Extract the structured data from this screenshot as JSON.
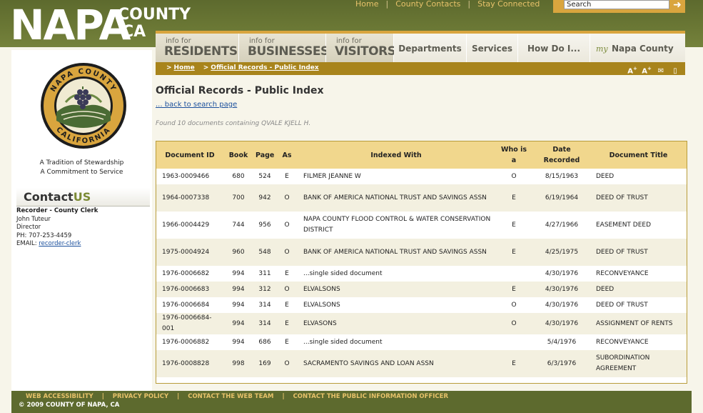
{
  "logo": {
    "napa": "NAPA",
    "county": "COUNTY",
    "ca": "CA"
  },
  "utility_links": [
    "Home",
    "County Contacts",
    "Stay Connected"
  ],
  "search": {
    "value": "Search"
  },
  "nav": {
    "residents": {
      "small": "info for",
      "big": "RESIDENTS"
    },
    "businesses": {
      "small": "info for",
      "big": "BUSINESSES"
    },
    "visitors": {
      "small": "info for",
      "big": "VISITORS"
    },
    "departments": "Departments",
    "services": "Services",
    "how_do_i": "How Do I...",
    "my": "my",
    "my_rest": "Napa County"
  },
  "breadcrumb": {
    "home": "Home",
    "current": "Official Records - Public Index"
  },
  "sidebar": {
    "seal_text_top": "NAPA COUNTY",
    "seal_text_bottom": "CALIFORNIA",
    "tagline_1": "A Tradition of Stewardship",
    "tagline_2": "A Commitment to Service",
    "contact_title_a": "Contact",
    "contact_title_b": "US",
    "dept": "Recorder - County Clerk",
    "name": "John Tuteur",
    "role": "Director",
    "phone": "PH: 707-253-4459",
    "email_label": "EMAIL: ",
    "email_link": "recorder-clerk"
  },
  "main": {
    "title": "Official Records - Public Index",
    "back_link": "... back to search page",
    "found": "Found 10 documents containing QVALE KJELL H."
  },
  "table": {
    "headers": {
      "doc_id": "Document ID",
      "book": "Book",
      "page": "Page",
      "as": "As",
      "indexed_with": "Indexed With",
      "who_is_1": "Who is",
      "who_is_2": "a",
      "date_1": "Date",
      "date_2": "Recorded",
      "title": "Document Title"
    },
    "rows": [
      {
        "id": "1963-0009466",
        "book": "680",
        "page": "524",
        "as": "E",
        "with": "FILMER JEANNE W",
        "who": "O",
        "date": "8/15/1963",
        "title": "DEED"
      },
      {
        "id": "1964-0007338",
        "book": "700",
        "page": "942",
        "as": "O",
        "with": "BANK OF AMERICA NATIONAL TRUST AND SAVINGS ASSN",
        "who": "E",
        "date": "6/19/1964",
        "title": "DEED OF TRUST"
      },
      {
        "id": "1966-0004429",
        "book": "744",
        "page": "956",
        "as": "O",
        "with": "NAPA COUNTY FLOOD CONTROL & WATER CONSERVATION DISTRICT",
        "who": "E",
        "date": "4/27/1966",
        "title": "EASEMENT DEED"
      },
      {
        "id": "1975-0004924",
        "book": "960",
        "page": "548",
        "as": "O",
        "with": "BANK OF AMERICA NATIONAL TRUST AND SAVINGS ASSN",
        "who": "E",
        "date": "4/25/1975",
        "title": "DEED OF TRUST"
      },
      {
        "id": "1976-0006682",
        "book": "994",
        "page": "311",
        "as": "E",
        "with": "...single sided document",
        "who": "",
        "date": "4/30/1976",
        "title": "RECONVEYANCE"
      },
      {
        "id": "1976-0006683",
        "book": "994",
        "page": "312",
        "as": "O",
        "with": "ELVALSONS",
        "who": "E",
        "date": "4/30/1976",
        "title": "DEED"
      },
      {
        "id": "1976-0006684",
        "book": "994",
        "page": "314",
        "as": "E",
        "with": "ELVALSONS",
        "who": "O",
        "date": "4/30/1976",
        "title": "DEED OF TRUST"
      },
      {
        "id": "1976-0006684-001",
        "book": "994",
        "page": "314",
        "as": "E",
        "with": "ELVASONS",
        "who": "O",
        "date": "4/30/1976",
        "title": "ASSIGNMENT OF RENTS"
      },
      {
        "id": "1976-0006882",
        "book": "994",
        "page": "686",
        "as": "E",
        "with": "...single sided document",
        "who": "",
        "date": "5/4/1976",
        "title": "RECONVEYANCE"
      },
      {
        "id": "1976-0008828",
        "book": "998",
        "page": "169",
        "as": "O",
        "with": "SACRAMENTO SAVINGS AND LOAN ASSN",
        "who": "E",
        "date": "6/3/1976",
        "title": "SUBORDINATION AGREEMENT"
      }
    ]
  },
  "footer": {
    "links": [
      "WEB ACCESSIBILITY",
      "PRIVACY POLICY",
      "CONTACT THE WEB TEAM",
      "CONTACT THE PUBLIC INFORMATION OFFICER"
    ],
    "copyright": "© 2009 COUNTY OF NAPA, CA"
  },
  "colors": {
    "header_green": "#5d6a2e",
    "gold": "#d9a53e",
    "crumb_gold": "#a8841c",
    "table_header": "#f1d78d",
    "link_blue": "#1a4f9c"
  },
  "icons": [
    "search-go-icon",
    "text-larger-icon",
    "text-largest-icon",
    "email-icon",
    "print-icon"
  ]
}
